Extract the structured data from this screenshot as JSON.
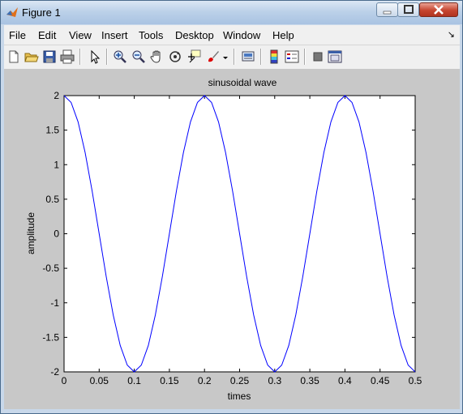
{
  "window": {
    "title": "Figure 1"
  },
  "menu": {
    "items": [
      "File",
      "Edit",
      "View",
      "Insert",
      "Tools",
      "Desktop",
      "Window",
      "Help"
    ]
  },
  "toolbar": {
    "buttons": [
      "new-figure-icon",
      "open-file-icon",
      "save-icon",
      "print-icon",
      "edit-plot-arrow-icon",
      "zoom-in-icon",
      "zoom-out-icon",
      "pan-hand-icon",
      "rotate-3d-icon",
      "data-cursor-icon",
      "brush-icon",
      "brush-dropdown-icon",
      "link-plot-icon",
      "insert-colorbar-icon",
      "insert-legend-icon",
      "hide-plot-tools-icon",
      "show-plot-tools-icon"
    ]
  },
  "colors": {
    "line": "#0000ff",
    "figure_bg": "#c8c8c8",
    "axes_bg": "#ffffff"
  },
  "chart_data": {
    "type": "line",
    "title": "sinusoidal wave",
    "xlabel": "times",
    "ylabel": "amplitude",
    "xlim": [
      0,
      0.5
    ],
    "ylim": [
      -2,
      2
    ],
    "xticks": [
      "0",
      "0.05",
      "0.1",
      "0.15",
      "0.2",
      "0.25",
      "0.3",
      "0.35",
      "0.4",
      "0.45",
      "0.5"
    ],
    "yticks": [
      "-2",
      "-1.5",
      "-1",
      "-0.5",
      "0",
      "0.5",
      "1",
      "1.5",
      "2"
    ],
    "grid": false,
    "series": [
      {
        "x": [
          0,
          0.01,
          0.02,
          0.03,
          0.04,
          0.05,
          0.06,
          0.07,
          0.08,
          0.09,
          0.1,
          0.11,
          0.12,
          0.13,
          0.14,
          0.15,
          0.16,
          0.17,
          0.18,
          0.19,
          0.2,
          0.21,
          0.22,
          0.23,
          0.24,
          0.25,
          0.26,
          0.27,
          0.28,
          0.29,
          0.3,
          0.31,
          0.32,
          0.33,
          0.34,
          0.35,
          0.36,
          0.37,
          0.38,
          0.39,
          0.4,
          0.41,
          0.42,
          0.43,
          0.44,
          0.45,
          0.46,
          0.47,
          0.48,
          0.49,
          0.5
        ],
        "y": [
          2,
          1.902,
          1.618,
          1.176,
          0.618,
          0,
          -0.618,
          -1.176,
          -1.618,
          -1.902,
          -2,
          -1.902,
          -1.618,
          -1.176,
          -0.618,
          0,
          0.618,
          1.176,
          1.618,
          1.902,
          2,
          1.902,
          1.618,
          1.176,
          0.618,
          0,
          -0.618,
          -1.176,
          -1.618,
          -1.902,
          -2,
          -1.902,
          -1.618,
          -1.176,
          -0.618,
          0,
          0.618,
          1.176,
          1.618,
          1.902,
          2,
          1.902,
          1.618,
          1.176,
          0.618,
          0,
          -0.618,
          -1.176,
          -1.618,
          -1.902,
          -2
        ]
      }
    ]
  }
}
